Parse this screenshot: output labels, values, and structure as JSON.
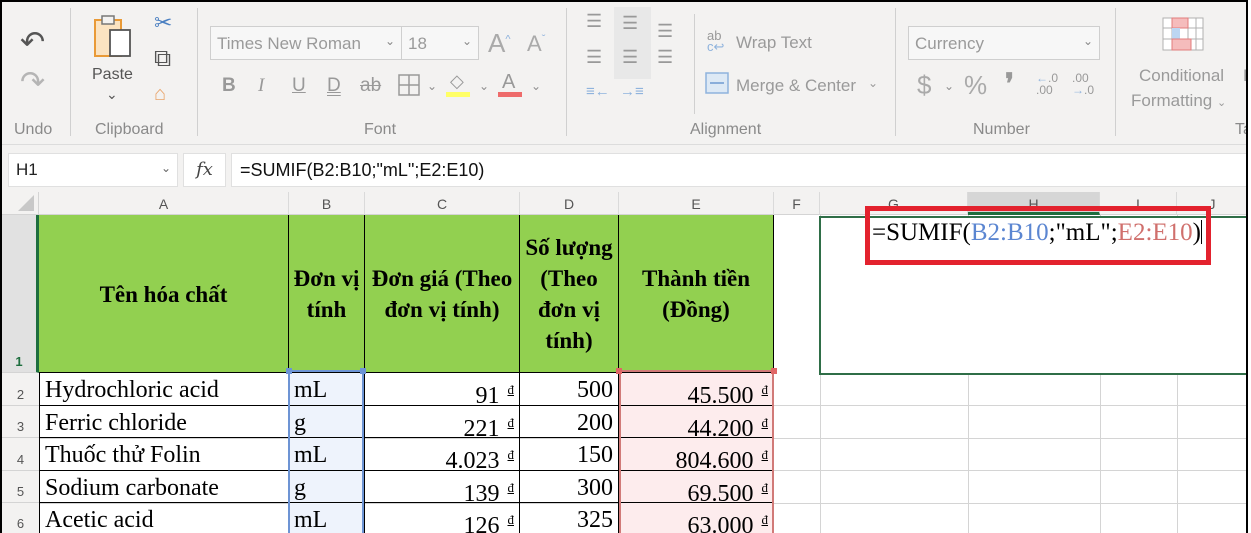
{
  "ribbon": {
    "undo": {
      "label": "Undo",
      "undo_icon": "undo-icon",
      "redo_icon": "redo-icon"
    },
    "clipboard": {
      "label": "Clipboard",
      "paste_label": "Paste",
      "paste_dropdown": "⌄",
      "cut_icon": "✂",
      "copy_icon": "⧉",
      "format_painter_icon": "🖌"
    },
    "font": {
      "label": "Font",
      "font_name": "Times New Roman",
      "font_size": "18",
      "grow_font": "A",
      "shrink_font": "A",
      "bold": "B",
      "italic": "I",
      "underline": "U",
      "double_underline": "D",
      "strikethrough": "ab",
      "fill_color": "#ffff66",
      "font_color": "#ee6b6b"
    },
    "alignment": {
      "label": "Alignment",
      "wrap_text": "Wrap Text",
      "merge_center": "Merge & Center"
    },
    "number": {
      "label": "Number",
      "format": "Currency",
      "currency": "$",
      "percent": "%",
      "comma": "❜",
      "inc_decimal": ".00",
      "dec_decimal": ".0"
    },
    "styles": {
      "conditional_formatting_line1": "Conditional",
      "conditional_formatting_line2": "Formatting",
      "next_group_partial": "F",
      "tab_label_partial": "Ta"
    }
  },
  "formula_bar": {
    "name_box": "H1",
    "fx_label": "fx",
    "formula": "=SUMIF(B2:B10;\"mL\";E2:E10)"
  },
  "columns": [
    "A",
    "B",
    "C",
    "D",
    "E",
    "F",
    "G",
    "H",
    "I",
    "J"
  ],
  "active_column": "H",
  "rows": [
    "1",
    "2",
    "3",
    "4",
    "5",
    "6"
  ],
  "table": {
    "headers": {
      "A": "Tên hóa chất",
      "B": "Đơn vị tính",
      "C": "Đơn giá (Theo đơn vị tính)",
      "D": "Số lượng (Theo đơn vị tính)",
      "E": "Thành tiền (Đồng)"
    },
    "header_lines": {
      "B": [
        "Đơn vị",
        "tính"
      ],
      "C": [
        "Đơn giá (Theo",
        "đơn vị tính)"
      ],
      "D": [
        "Số lượng",
        "(Theo",
        "đơn vị",
        "tính)"
      ],
      "E": [
        "Thành tiền",
        "(Đồng)"
      ]
    },
    "currency_symbol": "đ",
    "rows": [
      {
        "name": "Hydrochloric acid",
        "unit": "mL",
        "price": "91",
        "qty": "500",
        "total": "45.500"
      },
      {
        "name": "Ferric chloride",
        "unit": "g",
        "price": "221",
        "qty": "200",
        "total": "44.200"
      },
      {
        "name": "Thuốc thử Folin",
        "unit": "mL",
        "price": "4.023",
        "qty": "150",
        "total": "804.600"
      },
      {
        "name": "Sodium carbonate",
        "unit": "g",
        "price": "139",
        "qty": "300",
        "total": "69.500"
      },
      {
        "name": "Acetic acid",
        "unit": "mL",
        "price": "126",
        "qty": "325",
        "total": "63.000"
      }
    ]
  },
  "edit_cell": {
    "prefix": "=SUMIF(",
    "ref1": "B2:B10",
    "sep1": ";\"mL\";",
    "ref2": "E2:E10",
    "suffix": ")"
  },
  "colors": {
    "header_fill": "#92d050",
    "ref1": "#5b86d1",
    "ref2": "#d0706d",
    "highlight_box": "#e3222e",
    "selection": "#2f6e47"
  }
}
